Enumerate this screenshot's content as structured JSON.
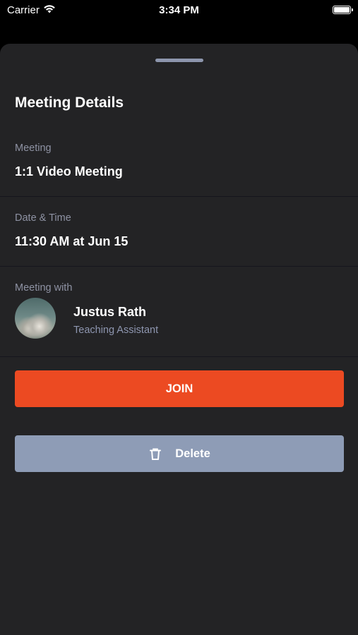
{
  "status_bar": {
    "carrier": "Carrier",
    "time": "3:34 PM",
    "wifi_icon": "wifi-icon",
    "battery_icon": "battery-icon"
  },
  "sheet": {
    "title": "Meeting Details",
    "meeting": {
      "label": "Meeting",
      "value": "1:1 Video Meeting"
    },
    "date_time": {
      "label": "Date & Time",
      "value": "11:30 AM at Jun 15"
    },
    "meeting_with": {
      "label": "Meeting with",
      "name": "Justus Rath",
      "role": "Teaching Assistant"
    },
    "join_button": {
      "label": "JOIN",
      "color": "#ec4a22"
    },
    "delete_button": {
      "label": "Delete",
      "icon": "trash-icon",
      "color": "#8e9cb6"
    }
  },
  "colors": {
    "background": "#000000",
    "sheet_background": "#232325",
    "label": "#8e92a3",
    "grabber": "#8d96ad"
  }
}
